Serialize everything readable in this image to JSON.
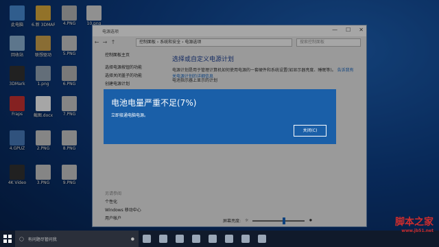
{
  "desktop": {
    "icons": [
      {
        "label": "此电脑"
      },
      {
        "label": "6.新 3DMARK"
      },
      {
        "label": "4.PNG"
      },
      {
        "label": "10.png"
      },
      {
        "label": "回收站"
      },
      {
        "label": "联想驱动"
      },
      {
        "label": "5.PNG"
      },
      {
        "label": "3DMark"
      },
      {
        "label": "1.png"
      },
      {
        "label": "6.PNG"
      },
      {
        "label": "Fraps"
      },
      {
        "label": "截图.docx"
      },
      {
        "label": "7.PNG"
      },
      {
        "label": "4.GPUZ"
      },
      {
        "label": "2.PNG"
      },
      {
        "label": "8.PNG"
      },
      {
        "label": "4K Video"
      },
      {
        "label": "3.PNG"
      },
      {
        "label": "9.PNG"
      }
    ]
  },
  "window": {
    "title": "电源选项",
    "breadcrumb": "控制面板 › 系统和安全 › 电源选项",
    "search_placeholder": "搜索控制面板",
    "side": {
      "home": "控制面板主页",
      "items": [
        "选择电源按钮的功能",
        "选择关闭盖子的功能",
        "创建电源计划"
      ]
    },
    "main": {
      "heading": "选择或自定义电源计划",
      "description": "电源计划是用于管理计算机如何使用电源的一套硬件和系统设置(如显示器亮度、睡眠等)。",
      "link": "告诉我有关电源计划的详细信息",
      "section": "电池指示器上显示的计划"
    },
    "see_also": {
      "header": "另请参阅",
      "items": [
        "个性化",
        "Windows 移动中心",
        "用户帐户"
      ]
    },
    "brightness_label": "屏幕亮度:",
    "brightness_level": 0.6
  },
  "dialog": {
    "title": "电池电量严重不足(7%)",
    "message": "立即接通电脑电源。",
    "close_label": "关闭(C)"
  },
  "taskbar": {
    "search_placeholder": "有问题尽管问我"
  },
  "watermark": {
    "text": "脚本之家",
    "url": "www.jb51.net"
  }
}
